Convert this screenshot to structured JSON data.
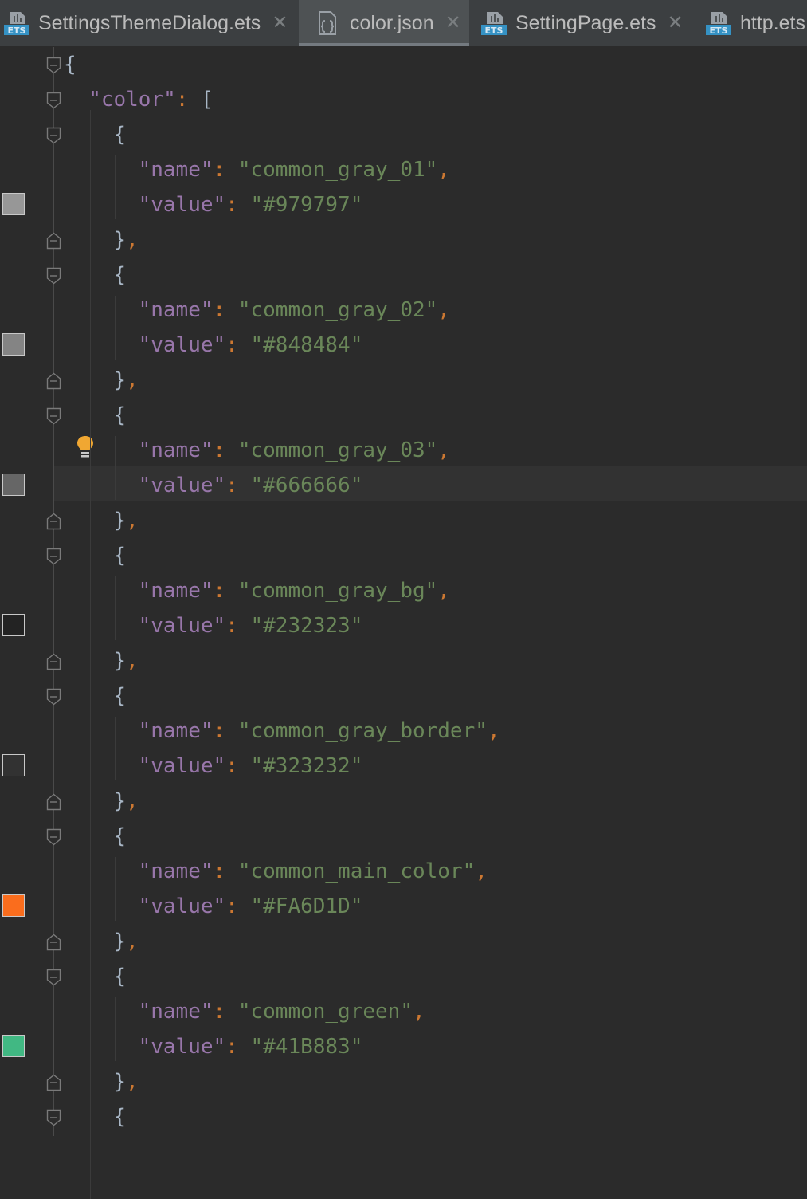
{
  "tabs": [
    {
      "label": "SettingsThemeDialog.ets",
      "icon": "ets-file-icon",
      "active": false,
      "closable": true
    },
    {
      "label": "color.json",
      "icon": "json-file-icon",
      "active": true,
      "closable": true
    },
    {
      "label": "SettingPage.ets",
      "icon": "ets-file-icon",
      "active": false,
      "closable": true
    },
    {
      "label": "http.ets",
      "icon": "ets-file-icon",
      "active": false,
      "closable": false
    }
  ],
  "icon_text": {
    "ets": "ETS"
  },
  "editor": {
    "syntax": {
      "open_brace": "{",
      "close_brace": "}",
      "open_bracket": "[",
      "colon": ":",
      "comma": ","
    },
    "root_key": "\"color\"",
    "name_key": "\"name\"",
    "value_key": "\"value\"",
    "entries": [
      {
        "name": "\"common_gray_01\"",
        "value": "\"#979797\"",
        "swatch": "#979797"
      },
      {
        "name": "\"common_gray_02\"",
        "value": "\"#848484\"",
        "swatch": "#848484"
      },
      {
        "name": "\"common_gray_03\"",
        "value": "\"#666666\"",
        "swatch": "#666666"
      },
      {
        "name": "\"common_gray_bg\"",
        "value": "\"#232323\"",
        "swatch": "#232323"
      },
      {
        "name": "\"common_gray_border\"",
        "value": "\"#323232\"",
        "swatch": "#323232"
      },
      {
        "name": "\"common_main_color\"",
        "value": "\"#FA6D1D\"",
        "swatch": "#FA6D1D"
      },
      {
        "name": "\"common_green\"",
        "value": "\"#41B883\"",
        "swatch": "#41B883"
      }
    ]
  }
}
